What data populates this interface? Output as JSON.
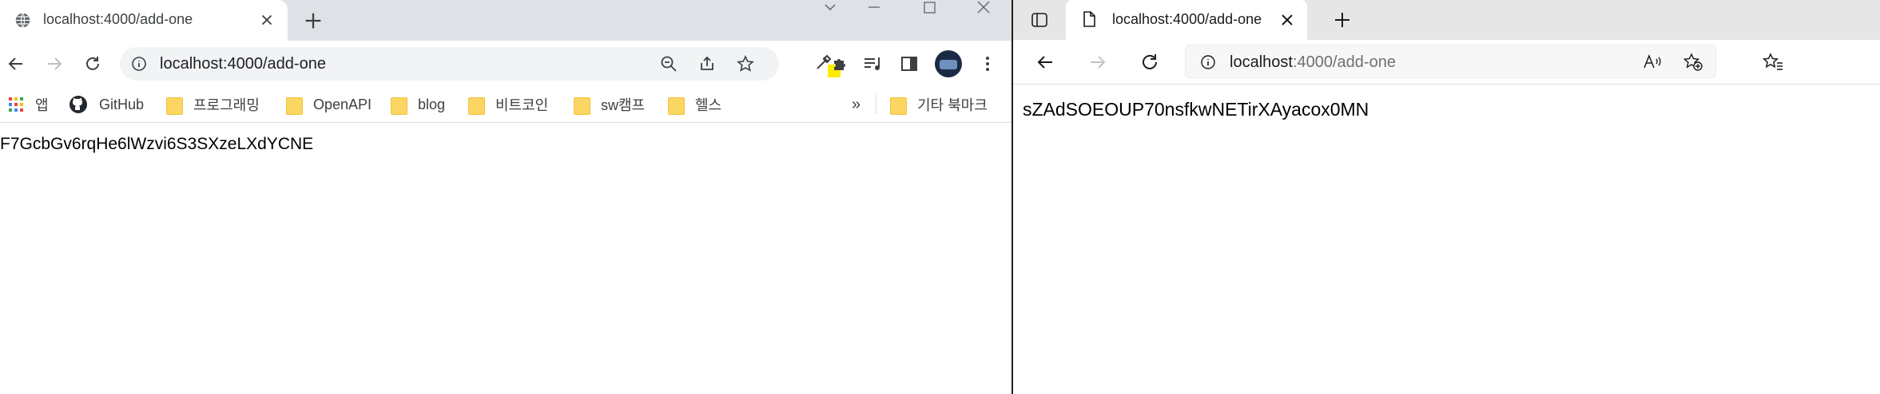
{
  "chrome": {
    "tab": {
      "title": "localhost:4000/add-one",
      "favicon": "globe-icon"
    },
    "address": {
      "url": "localhost:4000/add-one"
    },
    "bookmarks": [
      {
        "label": "앱",
        "icon": "apps-grid-icon"
      },
      {
        "label": "GitHub",
        "icon": "github-icon"
      },
      {
        "label": "프로그래밍",
        "icon": "folder-icon"
      },
      {
        "label": "OpenAPI",
        "icon": "folder-icon"
      },
      {
        "label": "blog",
        "icon": "folder-icon"
      },
      {
        "label": "비트코인",
        "icon": "folder-icon"
      },
      {
        "label": "sw캠프",
        "icon": "folder-icon"
      },
      {
        "label": "헬스",
        "icon": "folder-icon"
      }
    ],
    "overflow": "»",
    "other_bookmarks": "기타 북마크",
    "content": "F7GcbGv6rqHe6lWzvi6S3SXzeLXdYCNE"
  },
  "edge": {
    "tab": {
      "title": "localhost:4000/add-one",
      "favicon": "page-icon"
    },
    "address": {
      "host": "localhost",
      "path": ":4000/add-one"
    },
    "content": "sZAdSOEOUP70nsfkwNETirXAyacox0MN"
  },
  "colors": {
    "chrome_tabstrip": "#dee1e6",
    "edge_tabstrip": "#e6e6e6",
    "folder": "#fcd663",
    "extension_badge": "#ffeb00"
  }
}
